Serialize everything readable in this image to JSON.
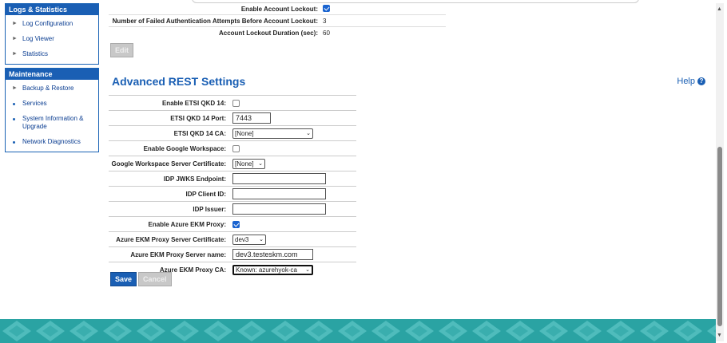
{
  "sidebar": {
    "logs_title": "Logs & Statistics",
    "logs_items": [
      "Log Configuration",
      "Log Viewer",
      "Statistics"
    ],
    "maint_title": "Maintenance",
    "maint_items": [
      "Backup & Restore",
      "Services",
      "System Information & Upgrade",
      "Network Diagnostics"
    ]
  },
  "lockout": {
    "rows": [
      {
        "label": "Enable Account Lockout:",
        "value": ""
      },
      {
        "label": "Number of Failed Authentication Attempts Before Account Lockout:",
        "value": "3"
      },
      {
        "label": "Account Lockout Duration (sec):",
        "value": "60"
      }
    ],
    "enable_checked": true,
    "edit_label": "Edit"
  },
  "section": {
    "title": "Advanced REST Settings",
    "help_label": "Help",
    "help_icon_glyph": "?"
  },
  "rest": {
    "etsi_enable_label": "Enable ETSI QKD 14:",
    "etsi_enable_checked": false,
    "etsi_port_label": "ETSI QKD 14 Port:",
    "etsi_port_value": "7443",
    "etsi_ca_label": "ETSI QKD 14 CA:",
    "etsi_ca_value": "[None]",
    "gw_enable_label": "Enable Google Workspace:",
    "gw_enable_checked": false,
    "gw_cert_label": "Google Workspace Server Certificate:",
    "gw_cert_value": "[None]",
    "idp_jwks_label": "IDP JWKS Endpoint:",
    "idp_jwks_value": "",
    "idp_client_label": "IDP Client ID:",
    "idp_client_value": "",
    "idp_issuer_label": "IDP Issuer:",
    "idp_issuer_value": "",
    "azure_enable_label": "Enable Azure EKM Proxy:",
    "azure_enable_checked": true,
    "azure_cert_label": "Azure EKM Proxy Server Certificate:",
    "azure_cert_value": "dev3",
    "azure_name_label": "Azure EKM Proxy Server name:",
    "azure_name_value": "dev3.testeskm.com",
    "azure_ca_label": "Azure EKM Proxy CA:",
    "azure_ca_value": "Known: azurehyok-ca"
  },
  "actions": {
    "save_label": "Save",
    "cancel_label": "Cancel"
  },
  "colors": {
    "brand_blue": "#1a5fb4",
    "footer_teal": "#2aa3a3"
  }
}
